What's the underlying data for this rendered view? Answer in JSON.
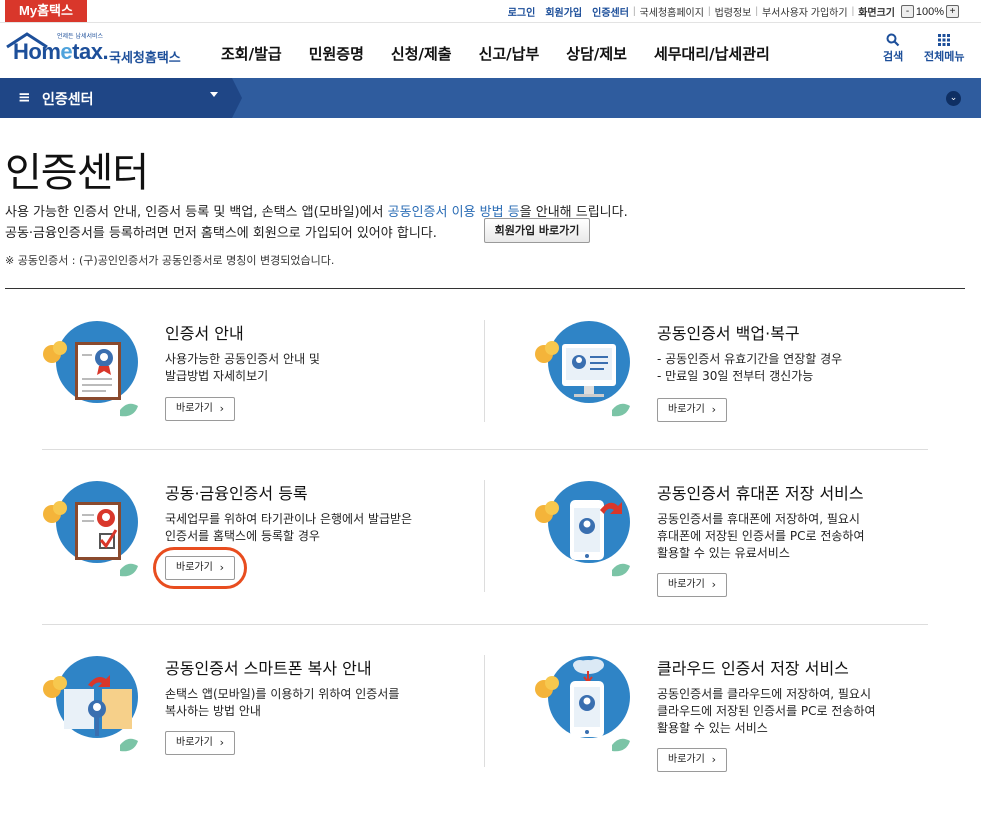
{
  "topbar": {
    "my_hometax": "My홈택스",
    "login": "로그인",
    "join": "회원가입",
    "cert_center": "인증센터",
    "links": [
      "국세청홈페이지",
      "법령정보",
      "부서사용자 가입하기"
    ],
    "screen_size": "화면크기",
    "zoom_minus": "-",
    "zoom_value": "100%",
    "zoom_plus": "+"
  },
  "header": {
    "logo_small": "언제든 납세서비스",
    "logo_main_a": "Hom",
    "logo_main_e": "e",
    "logo_main_b": "tax.",
    "logo_kr": "국세청홈택스",
    "menu": [
      "조회/발급",
      "민원증명",
      "신청/제출",
      "신고/납부",
      "상담/제보",
      "세무대리/납세관리"
    ],
    "search": "검색",
    "all_menu": "전체메뉴"
  },
  "navbar": {
    "title": "인증센터"
  },
  "page": {
    "title": "인증센터",
    "intro1_before": "사용 가능한 인증서 안내, 인증서 등록 및 백업, 손택스 앱(모바일)에서 ",
    "intro1_link": "공동인증서 이용 방법 등",
    "intro1_after": "을 안내해 드립니다.",
    "intro2": "공동·금융인증서를 등록하려면 먼저 홈택스에 회원으로 가입되어 있어야 합니다.",
    "join_button": "회원가입 바로가기",
    "note": "※ 공동인증서 : (구)공인인증서가 공동인증서로 명칭이 변경되었습니다."
  },
  "services": [
    {
      "title": "인증서 안내",
      "desc": [
        "사용가능한 공동인증서 안내 및",
        "발급방법 자세히보기"
      ],
      "button": "바로가기"
    },
    {
      "title": "공동인증서 백업·복구",
      "desc": [
        "- 공동인증서 유효기간을 연장할 경우",
        "- 만료일 30일 전부터 갱신가능"
      ],
      "button": "바로가기"
    },
    {
      "title": "공동·금융인증서 등록",
      "desc": [
        "국세업무를 위하여 타기관이나 은행에서 발급받은",
        "인증서를 홈택스에 등록할 경우"
      ],
      "button": "바로가기"
    },
    {
      "title": "공동인증서 휴대폰 저장 서비스",
      "desc": [
        "공동인증서를 휴대폰에 저장하여, 필요시",
        "휴대폰에 저장된 인증서를 PC로 전송하여",
        "활용할 수 있는 유료서비스"
      ],
      "button": "바로가기"
    },
    {
      "title": "공동인증서 스마트폰 복사 안내",
      "desc": [
        "손택스 앱(모바일)를 이용하기 위하여 인증서를",
        "복사하는 방법 안내"
      ],
      "button": "바로가기"
    },
    {
      "title": "클라우드 인증서 저장 서비스",
      "desc": [
        "공동인증서를 클라우드에 저장하여, 필요시",
        "클라우드에 저장된 인증서를 PC로 전송하여",
        "활용할 수 있는 서비스"
      ],
      "button": "바로가기"
    }
  ],
  "colors": {
    "brand_red": "#d9372b",
    "brand_blue": "#1d4f9a",
    "nav_bg": "#2f5c9e",
    "highlight": "#e84d1f"
  }
}
